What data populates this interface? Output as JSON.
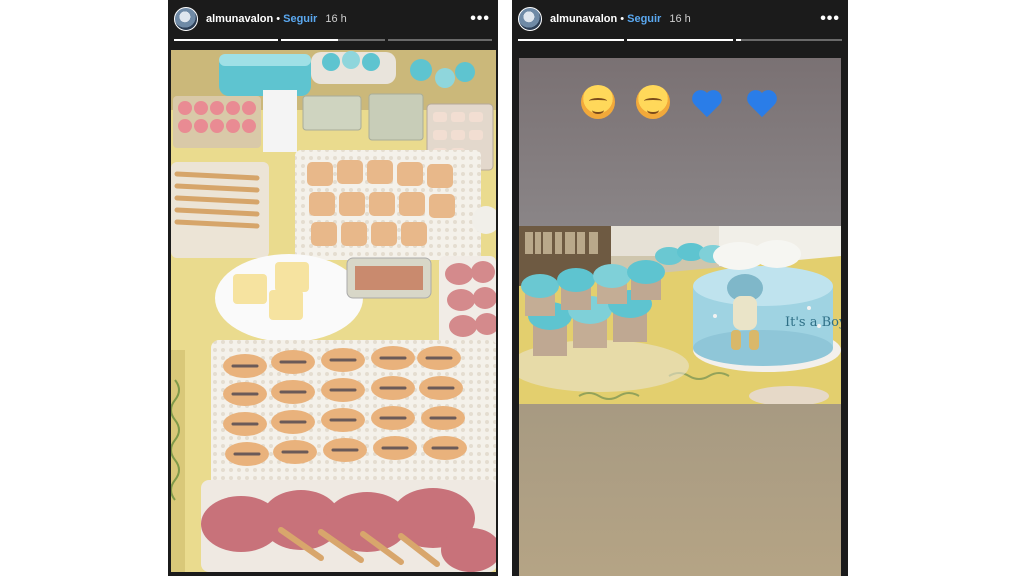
{
  "stories": [
    {
      "username": "almunavalon",
      "separator": "•",
      "follow_label": "Seguir",
      "time_ago": "16 h",
      "more_icon": "more-dots-icon",
      "progress": [
        1,
        0.55,
        0
      ]
    },
    {
      "username": "almunavalon",
      "separator": "•",
      "follow_label": "Seguir",
      "time_ago": "16 h",
      "more_icon": "more-dots-icon",
      "progress": [
        1,
        1,
        0.05
      ],
      "emojis": [
        "smiling-face-icon",
        "smiling-face-icon",
        "blue-heart-icon",
        "blue-heart-icon"
      ],
      "cake_text": "It's a Boy"
    }
  ],
  "colors": {
    "story_bg": "#1b1b1b",
    "follow": "#5aa8f0",
    "heart": "#2a7de8",
    "frosting": "#5ec4d0"
  }
}
